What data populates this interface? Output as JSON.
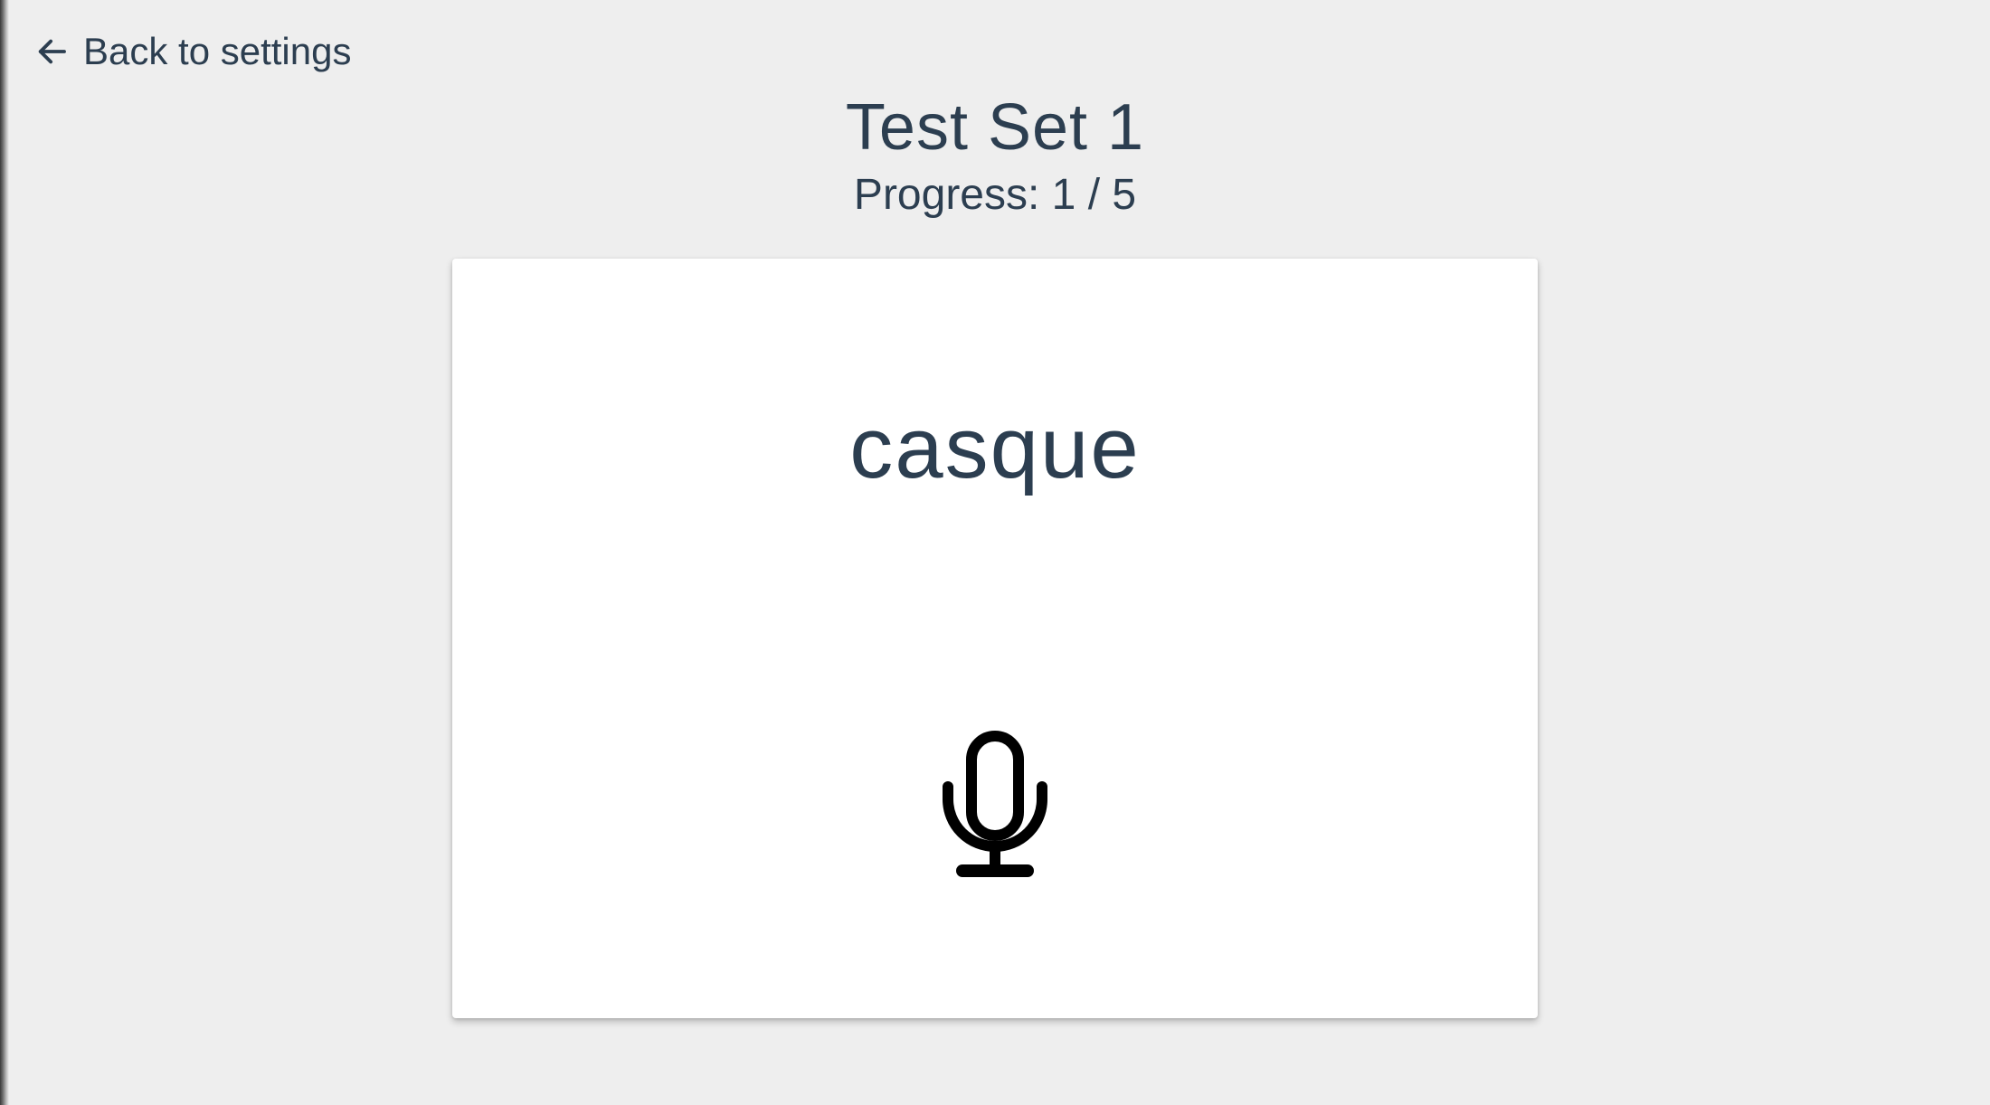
{
  "nav": {
    "back_label": "Back to settings",
    "back_icon": "arrow-left-icon"
  },
  "header": {
    "title": "Test Set 1",
    "progress_text": "Progress: 1 / 5",
    "progress": {
      "current": 1,
      "total": 5
    }
  },
  "card": {
    "word": "casque",
    "mic_icon": "microphone-icon"
  },
  "colors": {
    "background": "#eeeeee",
    "text": "#2c3e50",
    "card": "#ffffff",
    "icon": "#000000"
  }
}
